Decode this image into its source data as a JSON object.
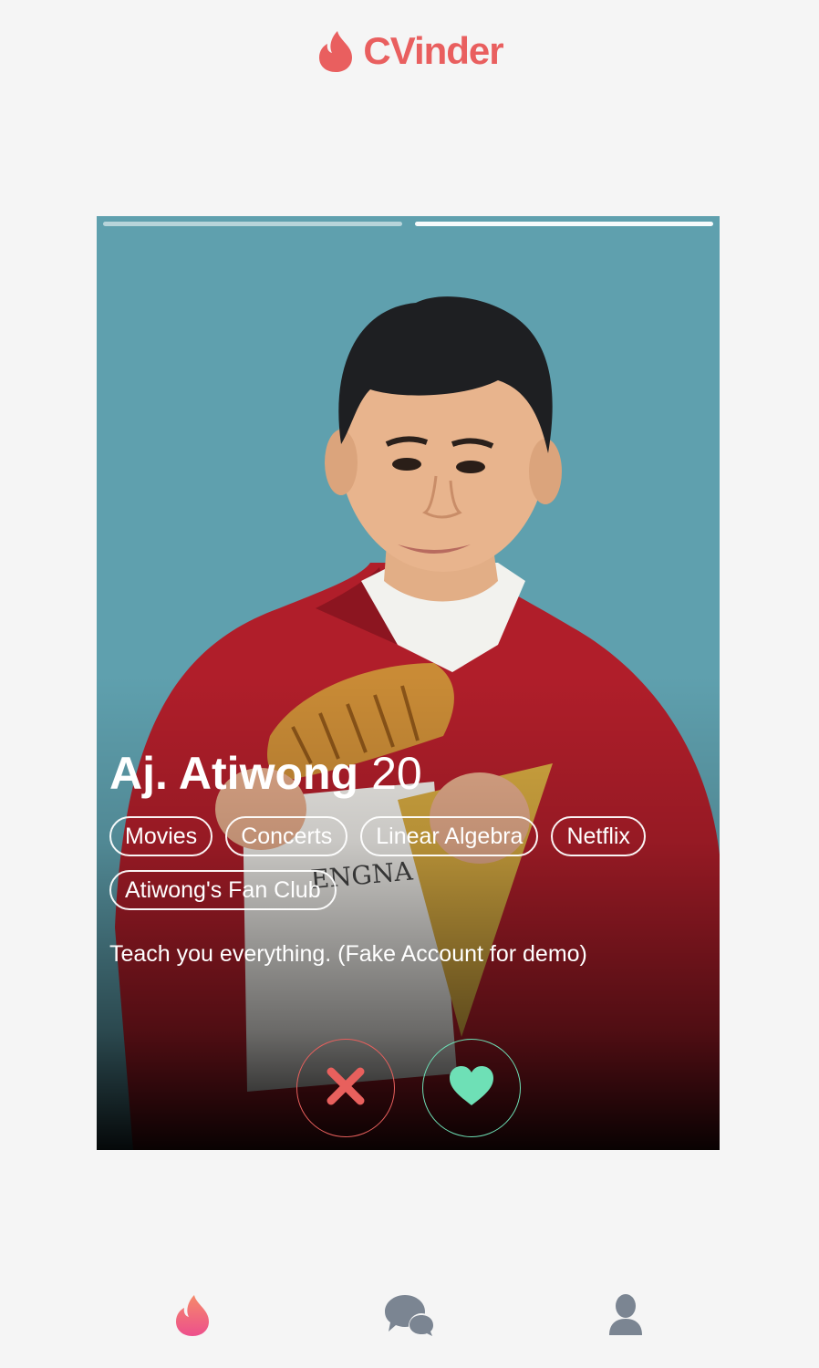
{
  "app": {
    "title": "CVinder",
    "brand_color": "#e95f5f"
  },
  "card": {
    "photo_count": 2,
    "active_photo": 2,
    "name": "Aj. Atiwong",
    "age": "20",
    "tags": [
      "Movies",
      "Concerts",
      "Linear Algebra",
      "Netflix",
      "Atiwong's Fan Club"
    ],
    "bio": "Teach you everything. (Fake Account for demo)"
  },
  "actions": {
    "nope": {
      "icon": "x-icon",
      "color": "#e8605d"
    },
    "like": {
      "icon": "heart-icon",
      "color": "#6ee0b6"
    }
  },
  "nav": {
    "items": [
      {
        "id": "swipe",
        "icon": "flame-icon",
        "active": true,
        "color": "#ef5a82"
      },
      {
        "id": "chat",
        "icon": "chat-bubbles-icon",
        "active": false,
        "color": "#7b8592"
      },
      {
        "id": "profile",
        "icon": "user-icon",
        "active": false,
        "color": "#7b8592"
      }
    ]
  }
}
